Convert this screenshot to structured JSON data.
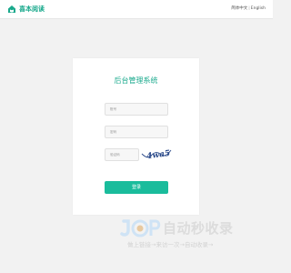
{
  "header": {
    "logo_icon": "house-book-icon",
    "brand": "喜本阅读",
    "lang_zh": "简体中文",
    "lang_sep": "|",
    "lang_en": "English"
  },
  "login": {
    "title": "后台管理系统",
    "username_placeholder": "账号",
    "password_placeholder": "密码",
    "captcha_placeholder": "验证码",
    "captcha_text": "4wa5",
    "submit_label": "登录"
  },
  "watermark": {
    "logo_text": "JP",
    "main_text": "自动秒收录",
    "sub_text": "做上链接→来访一次→自动收录→"
  },
  "colors": {
    "accent": "#19a98c",
    "button": "#1abc9c",
    "background": "#f2f2f2"
  }
}
